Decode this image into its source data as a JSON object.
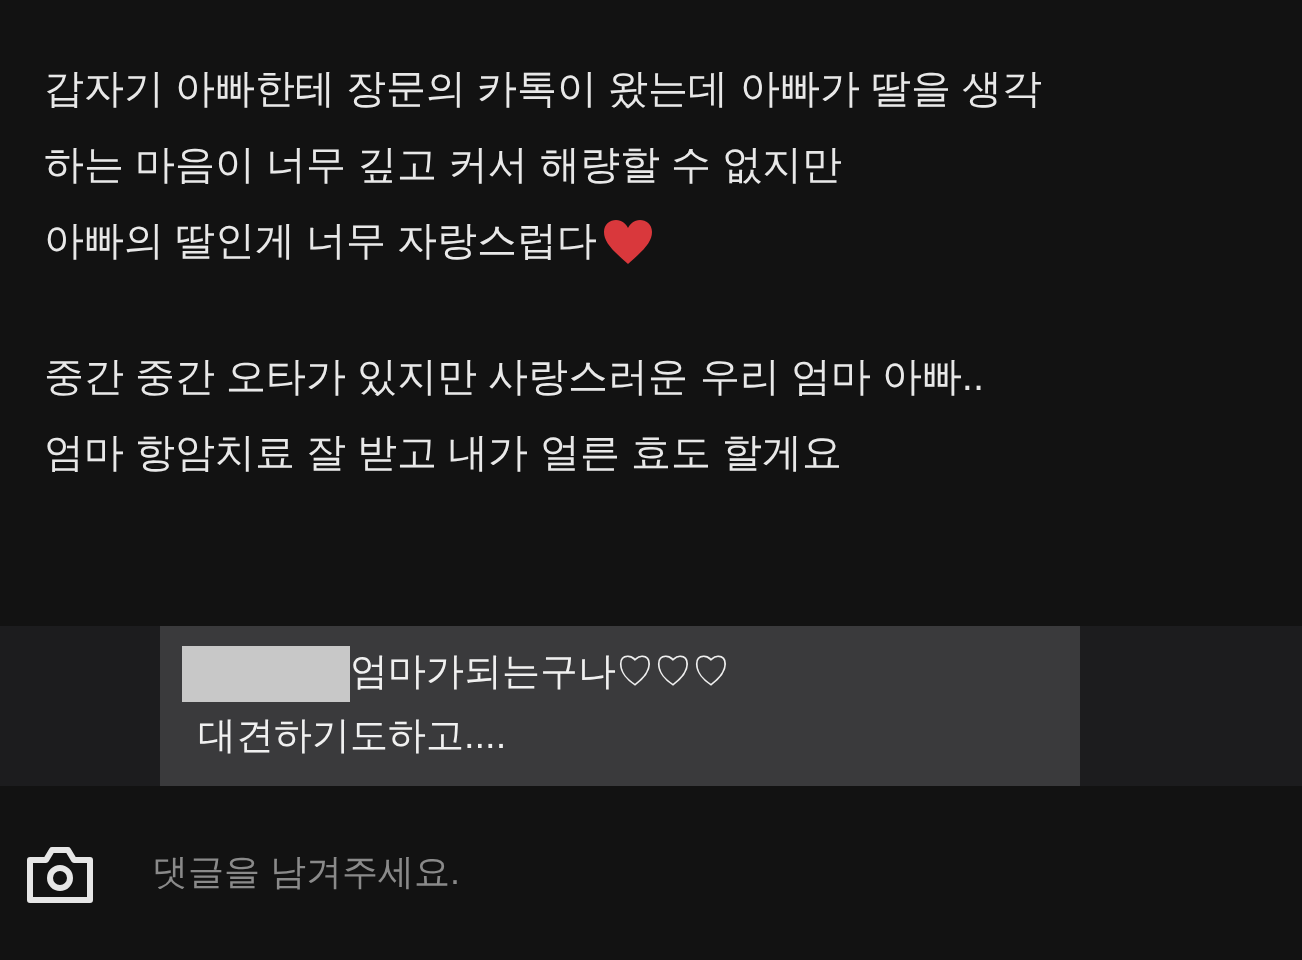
{
  "post": {
    "paragraphs": [
      {
        "lines": [
          "갑자기 아빠한테 장문의 카톡이 왔는데 아빠가 딸을 생각",
          "하는 마음이 너무 깊고 커서 해량할 수 없지만",
          "아빠의 딸인게 너무 자랑스럽다"
        ],
        "ends_with_heart": true
      },
      {
        "lines": [
          "중간 중간 오타가 있지만 사랑스러운 우리 엄마 아빠..",
          "엄마 항암치료 잘 받고 내가 얼른 효도 할게요"
        ],
        "ends_with_heart": false
      }
    ]
  },
  "comment": {
    "author_redacted": true,
    "lines": [
      "엄마가되는구나♡♡♡",
      "대견하기도하고...."
    ]
  },
  "comment_input": {
    "placeholder": "댓글을 남겨주세요."
  }
}
